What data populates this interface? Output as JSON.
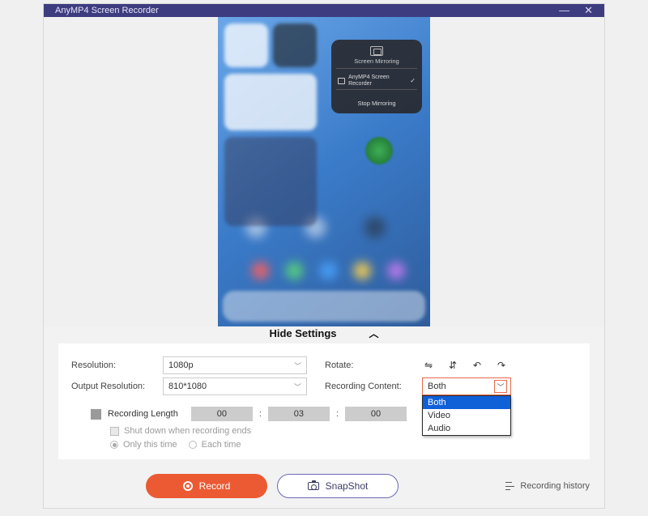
{
  "title": "AnyMP4 Screen Recorder",
  "mirror_popup": {
    "heading": "Screen Mirroring",
    "device": "AnyMP4 Screen Recorder",
    "stop": "Stop Mirroring"
  },
  "hide_settings": "Hide Settings",
  "settings": {
    "resolution_label": "Resolution:",
    "resolution_value": "1080p",
    "output_label": "Output Resolution:",
    "output_value": "810*1080",
    "rotate_label": "Rotate:",
    "rec_content_label": "Recording Content:",
    "rec_content_value": "Both",
    "rec_content_options": {
      "o0": "Both",
      "o1": "Video",
      "o2": "Audio"
    },
    "reclen_label": "Recording Length",
    "time": {
      "h": "00",
      "m": "03",
      "s": "00"
    },
    "shutdown": "Shut down when recording ends",
    "only_this": "Only this time",
    "each_time": "Each time"
  },
  "buttons": {
    "record": "Record",
    "snapshot": "SnapShot",
    "history": "Recording history"
  }
}
